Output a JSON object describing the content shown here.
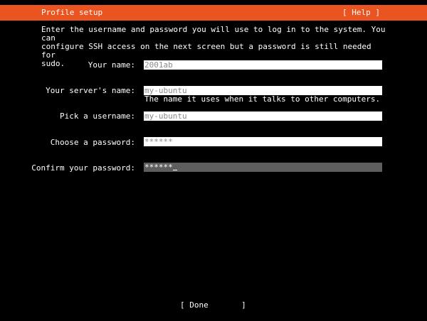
{
  "header": {
    "title": "Profile setup",
    "help_label": "[ Help ]",
    "bar_color": "#e95420"
  },
  "intro_text": "Enter the username and password you will use to log in to the system. You can\nconfigure SSH access on the next screen but a password is still needed for\nsudo.",
  "form": {
    "name": {
      "label": "Your name:",
      "value": "2001ab"
    },
    "server_name": {
      "label": "Your server's name:",
      "value": "my-ubuntu",
      "help": "The name it uses when it talks to other computers."
    },
    "username": {
      "label": "Pick a username:",
      "value": "my-ubuntu"
    },
    "password": {
      "label": "Choose a password:",
      "value": "******"
    },
    "confirm_password": {
      "label": "Confirm your password:",
      "value": "******"
    }
  },
  "done_button": {
    "label": "[ Done       ]"
  }
}
